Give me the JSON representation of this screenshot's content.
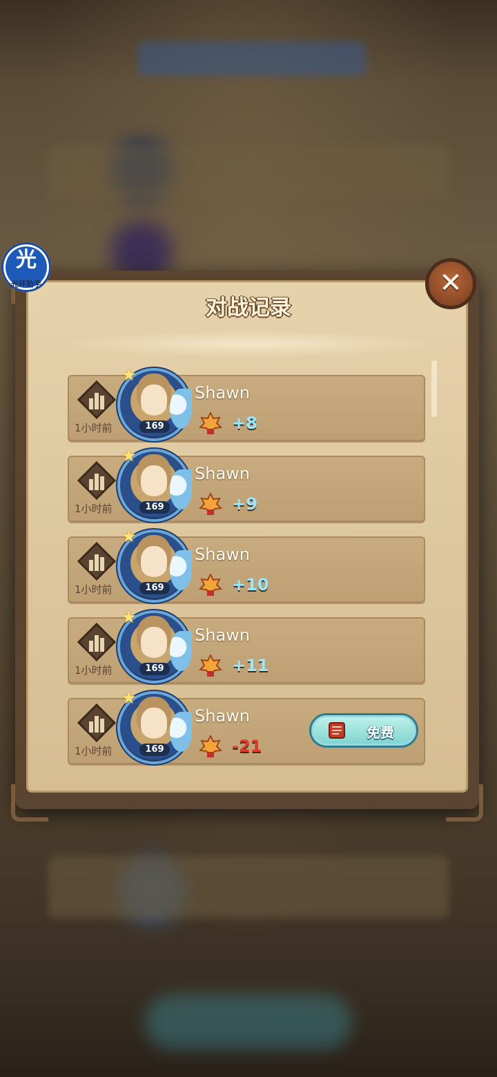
{
  "dialog": {
    "title": "对战记录",
    "close_label": "✕"
  },
  "helper": {
    "glyph": "光",
    "label": "光环助手"
  },
  "records": [
    {
      "time": "1小时前",
      "level": "169",
      "name": "Shawn",
      "score": "+8",
      "result": "win"
    },
    {
      "time": "1小时前",
      "level": "169",
      "name": "Shawn",
      "score": "+9",
      "result": "win"
    },
    {
      "time": "1小时前",
      "level": "169",
      "name": "Shawn",
      "score": "+10",
      "result": "win"
    },
    {
      "time": "1小时前",
      "level": "169",
      "name": "Shawn",
      "score": "+11",
      "result": "win"
    },
    {
      "time": "1小时前",
      "level": "169",
      "name": "Shawn",
      "score": "-21",
      "result": "loss",
      "free_button": "免费"
    }
  ],
  "icons": {
    "rank": "rank-bars-icon",
    "trophy": "trophy-icon",
    "replay": "replay-scroll-icon",
    "close": "close-icon"
  },
  "colors": {
    "win_score": "#9be7ff",
    "loss_score": "#e23a2a",
    "panel": "#dcc59c"
  }
}
